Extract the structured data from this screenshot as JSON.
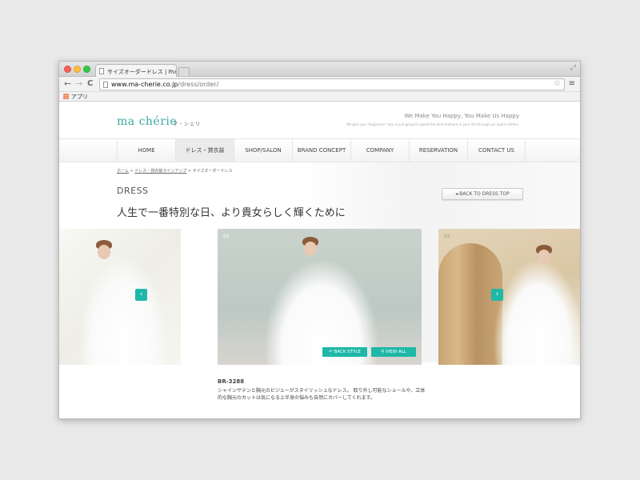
{
  "browser": {
    "tab_title": "サイズオーダードレス | ma",
    "tab_close": "×",
    "url_host": "www.ma-cherie.co.jp",
    "url_path": "/dress/order/",
    "back": "←",
    "forward": "→",
    "reload": "C",
    "star": "☆",
    "menu": "≡",
    "expand": "⤢",
    "bookmark_apps": "アプリ"
  },
  "site": {
    "logo": "ma chérie",
    "logo_kana": "マ・シェリ",
    "tagline": "We Make You Happy, You Make Us Happy",
    "subtagline": "We give you \"happiness\" who is just going to spend the best moment in your life through our joyful clothes.",
    "nav": [
      "HOME",
      "ドレス・貸衣装",
      "SHOP/SALON",
      "BRAND CONCEPT",
      "COMPANY",
      "RESERVATION",
      "CONTACT US"
    ],
    "nav_active": 1,
    "breadcrumb": {
      "home": "ホーム",
      "sep1": ">",
      "lineup": "ドレス・貸衣装ラインアップ",
      "sep2": ">",
      "current": "サイズオーダードレス"
    },
    "section_label": "DRESS",
    "headline": "人生で一番特別な日、より貴女らしく輝くために",
    "back_to_top": "◂  BACK TO DRESS TOP",
    "slides": [
      {
        "num": "01"
      },
      {
        "num": "02"
      }
    ],
    "arrow_prev": "‹",
    "arrow_next": "›",
    "btn_back_style": "↶ BACK STYLE",
    "btn_view_all": "⚲ VIEW ALL",
    "product_code": "BR-3288",
    "product_desc": "シャインサテンと胸元のビジューがスタイリッシュなドレス。 取り外し可能なショールや、立体的な胸元のカットは気になる上半身の悩みも自然にカバーしてくれます。"
  }
}
